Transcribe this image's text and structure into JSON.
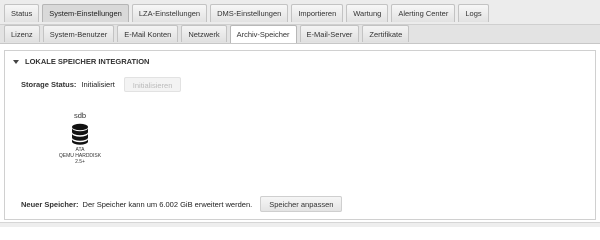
{
  "main_tabs": [
    {
      "label": "Status",
      "active": false
    },
    {
      "label": "System-Einstellungen",
      "active": true
    },
    {
      "label": "LZA-Einstellungen",
      "active": false
    },
    {
      "label": "DMS-Einstellungen",
      "active": false
    },
    {
      "label": "Importieren",
      "active": false
    },
    {
      "label": "Wartung",
      "active": false
    },
    {
      "label": "Alerting Center",
      "active": false
    },
    {
      "label": "Logs",
      "active": false
    }
  ],
  "sub_tabs": [
    {
      "label": "Lizenz",
      "active": false
    },
    {
      "label": "System-Benutzer",
      "active": false
    },
    {
      "label": "E-Mail Konten",
      "active": false
    },
    {
      "label": "Netzwerk",
      "active": false
    },
    {
      "label": "Archiv-Speicher",
      "active": true
    },
    {
      "label": "E-Mail-Server",
      "active": false
    },
    {
      "label": "Zertifikate",
      "active": false
    }
  ],
  "section": {
    "title": "LOKALE SPEICHER INTEGRATION",
    "storage_status_label": "Storage Status:",
    "storage_status_value": "Initialisiert",
    "initialize_button": "Initialisieren",
    "disk": {
      "name": "sdb",
      "icon": "database-icon",
      "vendor": "ATA",
      "model": "QEMU HARDDISK",
      "size": "2.5+"
    },
    "new_storage_label": "Neuer Speicher:",
    "new_storage_text": "Der Speicher kann um 6.002 GiB erweitert werden.",
    "adjust_button": "Speicher anpassen"
  }
}
